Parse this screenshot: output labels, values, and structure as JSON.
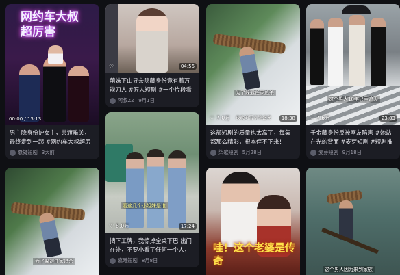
{
  "cards": [
    {
      "title": "男主隐身份护女主，共渡难关，最终走到一起 #网约车大叔超厉害 #天桥短剧",
      "author": "悬疑短剧",
      "date": "3天前",
      "time_badge": "00:00 / 13:13",
      "poster_text": "网约车大叔超厉害"
    },
    {
      "title": "萌妹下山寻亲隐藏身份竟有着万能刀人 #匠人短剧 #一个片段看了整部剧",
      "author": "阿叔ZZ",
      "date": "9月1日",
      "duration": "04:56"
    },
    {
      "title": "这部短剧的质量也太高了，每集都那么精彩，根本停不下来！",
      "author": "柒歌短剧",
      "date": "5月28日",
      "likes": "7.0万",
      "duration": "18:38",
      "caption": "为了躲避任家追杀",
      "caption2": "夜晚的雷家锦盛宴"
    },
    {
      "title": "千金藏身份反被室友陷害 #她站在光的背面 #麦芽短剧 #短剧推荐",
      "author": "麦芽短剧",
      "date": "9月18日",
      "likes": "7.6万",
      "duration": "23:03",
      "caption": "这个男人18年只手遮天"
    },
    {
      "title": "",
      "author": "",
      "date": "",
      "caption": "为了躲避任家追杀"
    },
    {
      "title": "摘下工牌，我惊掉全桌下巴 出门在外，不要小看了任何一个人，因为他...",
      "author": "嘉曦短剧",
      "date": "8月8日",
      "likes": "8.0万",
      "duration": "17:24",
      "caption": "看这几个小姐妹是谁"
    },
    {
      "title": "",
      "author": "",
      "date": "",
      "poster_text": "哇！这个老婆是传奇"
    },
    {
      "title": "",
      "author": "",
      "date": "",
      "caption": "这个男人因为来到家族"
    }
  ],
  "colors": {
    "background": "#0f1014",
    "card_info": "#1c1d24",
    "meta_text": "#9a9aa6"
  },
  "icons": {
    "like": "heart-icon",
    "author": "avatar-icon"
  }
}
